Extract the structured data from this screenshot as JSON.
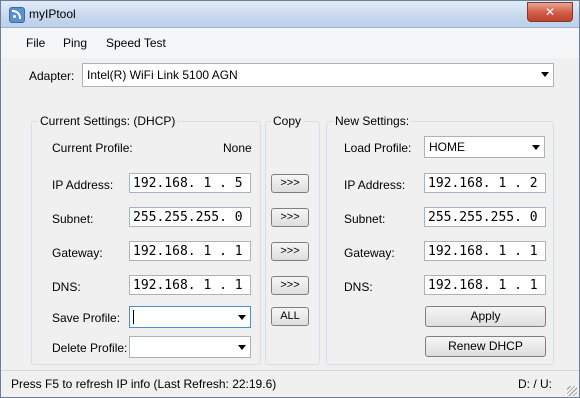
{
  "window": {
    "title": "myIPtool",
    "close_label": "✕"
  },
  "menu": {
    "items": [
      "File",
      "Ping",
      "Speed Test"
    ]
  },
  "adapter": {
    "label": "Adapter:",
    "value": "Intel(R) WiFi Link 5100 AGN"
  },
  "current": {
    "title": "Current Settings: (DHCP)",
    "profile_label": "Current Profile:",
    "profile_value": "None",
    "ip_label": "IP Address:",
    "ip_value": "192.168. 1 . 5",
    "subnet_label": "Subnet:",
    "subnet_value": "255.255.255. 0",
    "gateway_label": "Gateway:",
    "gateway_value": "192.168. 1 . 1",
    "dns_label": "DNS:",
    "dns_value": "192.168. 1 . 1",
    "save_label": "Save Profile:",
    "save_value": "",
    "delete_label": "Delete Profile:",
    "delete_value": ""
  },
  "copy": {
    "title": "Copy",
    "arrow_label": ">>>",
    "all_label": "ALL"
  },
  "new": {
    "title": "New Settings:",
    "load_label": "Load Profile:",
    "load_value": "HOME",
    "ip_label": "IP Address:",
    "ip_value": "192.168. 1 . 2",
    "subnet_label": "Subnet:",
    "subnet_value": "255.255.255. 0",
    "gateway_label": "Gateway:",
    "gateway_value": "192.168. 1 . 1",
    "dns_label": "DNS:",
    "dns_value": "192.168. 1 . 1",
    "apply_label": "Apply",
    "renew_label": "Renew DHCP"
  },
  "status": {
    "text": "Press F5 to refresh IP info (Last Refresh: 22:19.6)",
    "right": "D:  / U:"
  },
  "colors": {
    "title_gradient": "#c7d8ee",
    "close_red": "#c0402c",
    "window_bg": "#f0f0f0"
  }
}
